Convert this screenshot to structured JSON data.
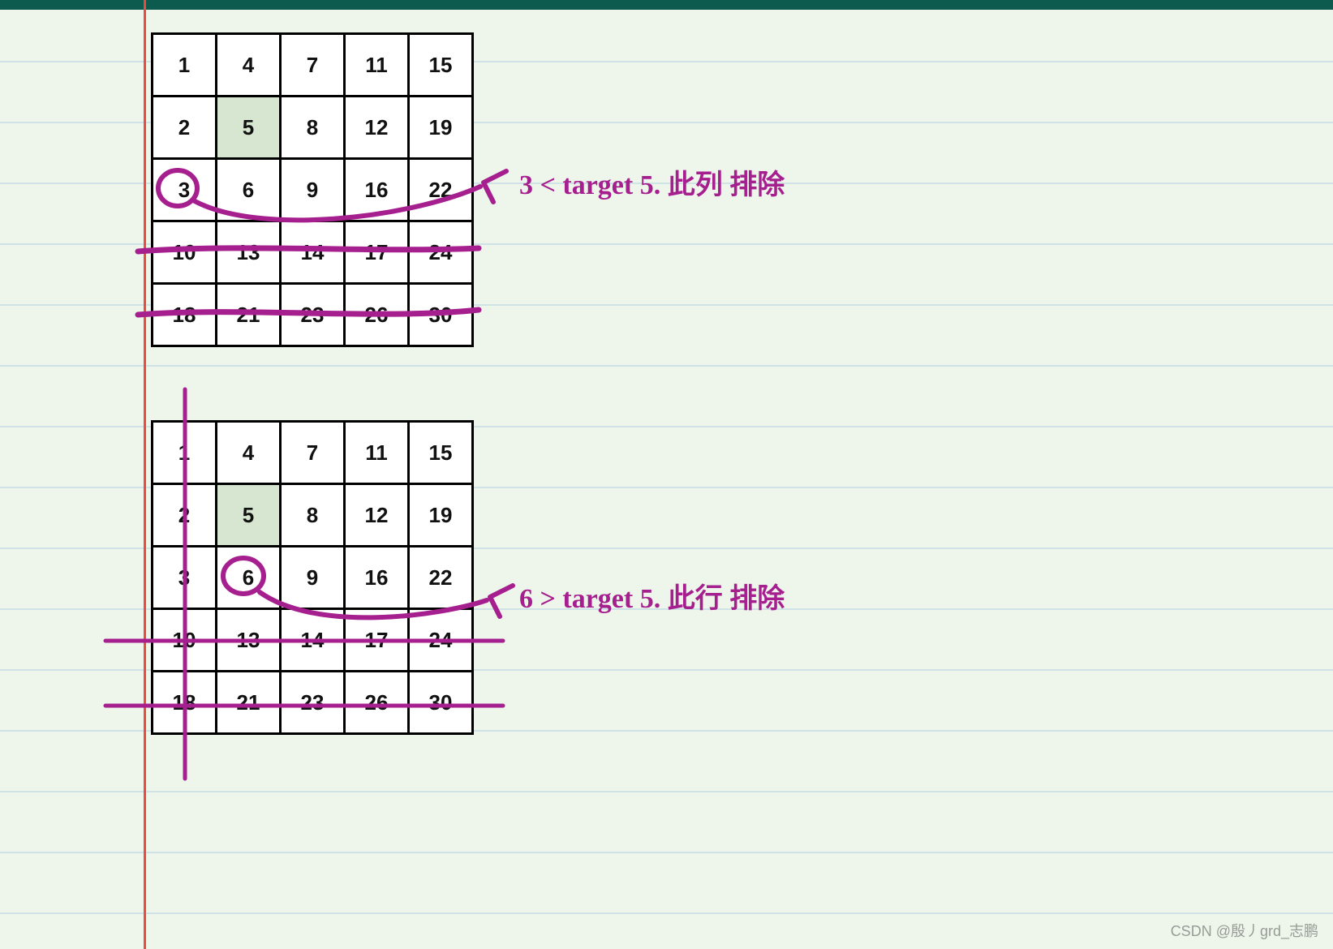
{
  "matrix1": {
    "rows": [
      [
        1,
        4,
        7,
        11,
        15
      ],
      [
        2,
        5,
        8,
        12,
        19
      ],
      [
        3,
        6,
        9,
        16,
        22
      ],
      [
        10,
        13,
        14,
        17,
        24
      ],
      [
        18,
        21,
        23,
        26,
        30
      ]
    ],
    "highlight": {
      "row": 1,
      "col": 1
    }
  },
  "matrix2": {
    "rows": [
      [
        1,
        4,
        7,
        11,
        15
      ],
      [
        2,
        5,
        8,
        12,
        19
      ],
      [
        3,
        6,
        9,
        16,
        22
      ],
      [
        10,
        13,
        14,
        17,
        24
      ],
      [
        18,
        21,
        23,
        26,
        30
      ]
    ],
    "highlight": {
      "row": 1,
      "col": 1
    }
  },
  "annotation1": "3 < target 5.  此列 排除",
  "annotation2": "6 > target 5.  此行 排除",
  "watermark": "CSDN @殷丿grd_志鹏"
}
